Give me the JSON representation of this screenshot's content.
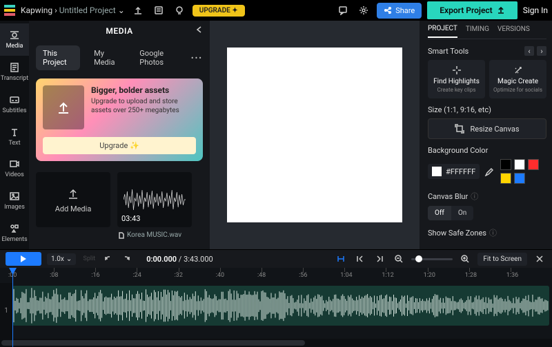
{
  "topbar": {
    "brand": "Kapwing",
    "project_name": "Untitled Project",
    "upgrade": "UPGRADE",
    "share": "Share",
    "export": "Export Project",
    "signin": "Sign In"
  },
  "rail": [
    {
      "label": "Media"
    },
    {
      "label": "Transcript"
    },
    {
      "label": "Subtitles"
    },
    {
      "label": "Text"
    },
    {
      "label": "Videos"
    },
    {
      "label": "Images"
    },
    {
      "label": "Elements"
    }
  ],
  "media_panel": {
    "title": "MEDIA",
    "tabs": [
      "This Project",
      "My Media",
      "Google Photos"
    ],
    "upgrade_card": {
      "title": "Bigger, bolder assets",
      "body": "Upgrade to upload and store assets over 250+ megabytes",
      "cta": "Upgrade ✨"
    },
    "add_tile": "Add Media",
    "clip": {
      "duration": "03:43",
      "filename": "Korea MUSIC.wav"
    }
  },
  "right": {
    "tabs": [
      "PROJECT",
      "TIMING",
      "VERSIONS"
    ],
    "smart_label": "Smart Tools",
    "smart": [
      {
        "title": "Find Highlights",
        "sub": "Create key clips"
      },
      {
        "title": "Magic Create",
        "sub": "Optimize for socials"
      }
    ],
    "size_label": "Size (1:1, 9:16, etc)",
    "resize": "Resize Canvas",
    "bg_label": "Background Color",
    "bg_hex": "#FFFFFF",
    "palette": [
      "#000000",
      "#FFFFFF",
      "#ff2d2d",
      "#ffd400",
      "#1d7bff"
    ],
    "blur_label": "Canvas Blur",
    "blur_options": [
      "Off",
      "On"
    ],
    "safe_label": "Show Safe Zones"
  },
  "timeline": {
    "speed": "1.0x",
    "split": "Split",
    "time_current": "0:00.000",
    "time_total": "3:43.000",
    "fit": "Fit to Screen",
    "ticks": [
      ":00",
      ":08",
      ":16",
      ":24",
      ":32",
      ":40",
      ":48",
      ":56",
      "1:04",
      "1:12",
      "1:20",
      "1:28",
      "1:36"
    ],
    "track_num": "1"
  }
}
